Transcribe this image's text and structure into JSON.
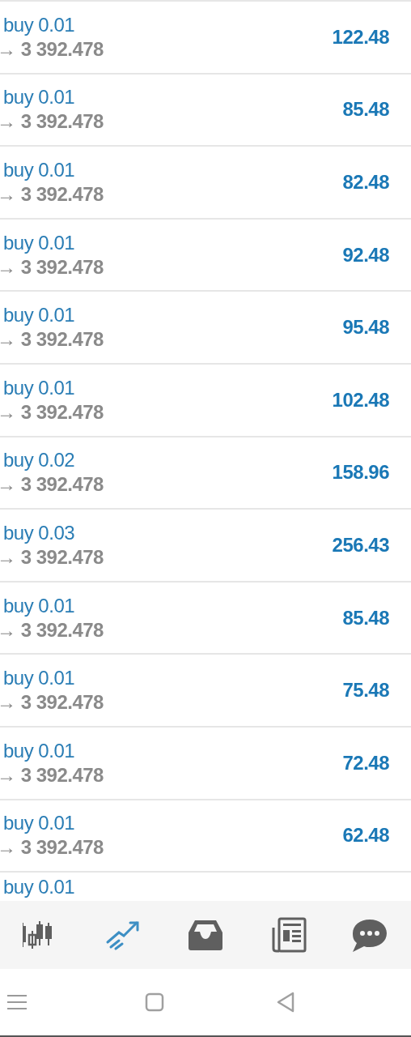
{
  "positions": [
    {
      "type": "buy 0.01",
      "price": "→ 3 392.478",
      "profit": "122.48"
    },
    {
      "type": "buy 0.01",
      "price": "→ 3 392.478",
      "profit": "85.48"
    },
    {
      "type": "buy 0.01",
      "price": "→ 3 392.478",
      "profit": "82.48"
    },
    {
      "type": "buy 0.01",
      "price": "→ 3 392.478",
      "profit": "92.48"
    },
    {
      "type": "buy 0.01",
      "price": "→ 3 392.478",
      "profit": "95.48"
    },
    {
      "type": "buy 0.01",
      "price": "→ 3 392.478",
      "profit": "102.48"
    },
    {
      "type": "buy 0.02",
      "price": "→ 3 392.478",
      "profit": "158.96"
    },
    {
      "type": "buy 0.03",
      "price": "→ 3 392.478",
      "profit": "256.43"
    },
    {
      "type": "buy 0.01",
      "price": "→ 3 392.478",
      "profit": "85.48"
    },
    {
      "type": "buy 0.01",
      "price": "→ 3 392.478",
      "profit": "75.48"
    },
    {
      "type": "buy 0.01",
      "price": "→ 3 392.478",
      "profit": "72.48"
    },
    {
      "type": "buy 0.01",
      "price": "→ 3 392.478",
      "profit": "62.48"
    },
    {
      "type": "buy 0.01"
    }
  ],
  "tabs": [
    {
      "kind": "quotes",
      "selected": false
    },
    {
      "kind": "trade",
      "selected": true
    },
    {
      "kind": "inbox",
      "selected": false
    },
    {
      "kind": "news",
      "selected": false
    },
    {
      "kind": "chat",
      "selected": false
    }
  ],
  "system_bar": [
    {
      "kind": "menu"
    },
    {
      "kind": "home"
    },
    {
      "kind": "back"
    }
  ]
}
